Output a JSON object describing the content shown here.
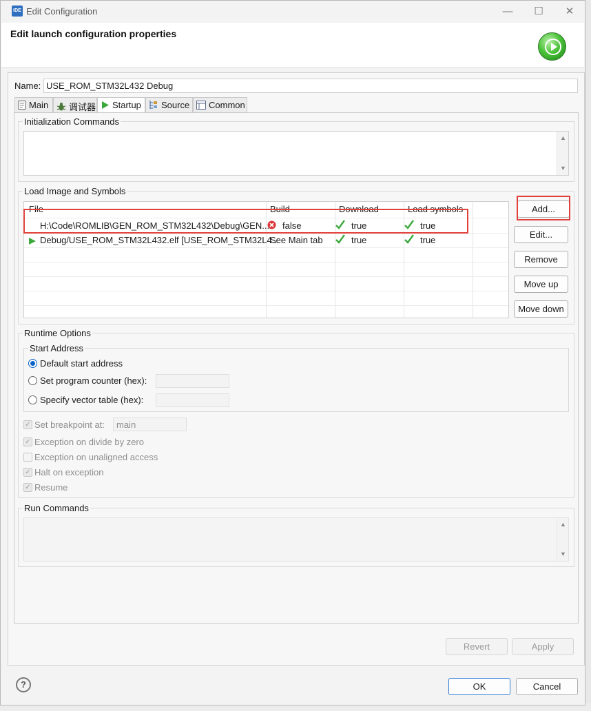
{
  "window": {
    "title": "Edit Configuration",
    "app_icon_text": "IDE",
    "minimize": "—",
    "maximize": "☐",
    "close": "✕"
  },
  "header": {
    "title": "Edit launch configuration properties"
  },
  "config": {
    "name_label": "Name:",
    "name_value": "USE_ROM_STM32L432 Debug"
  },
  "tabs": [
    {
      "label": "Main",
      "icon": "document-icon",
      "active": false
    },
    {
      "label": "调试器",
      "icon": "bug-icon",
      "active": false
    },
    {
      "label": "Startup",
      "icon": "play-icon",
      "active": true
    },
    {
      "label": "Source",
      "icon": "source-icon",
      "active": false
    },
    {
      "label": "Common",
      "icon": "common-icon",
      "active": false
    }
  ],
  "init": {
    "label": "Initialization Commands",
    "value": ""
  },
  "load": {
    "label": "Load Image and Symbols",
    "columns": [
      "File",
      "Build",
      "Download",
      "Load symbols"
    ],
    "rows": [
      {
        "file": "H:\\Code\\ROMLIB\\GEN_ROM_STM32L432\\Debug\\GEN...",
        "build": "false",
        "build_icon": "error-icon",
        "download": "true",
        "symbols": "true"
      },
      {
        "file": "Debug/USE_ROM_STM32L432.elf [USE_ROM_STM32L4...",
        "build": "See Main tab",
        "build_icon": "",
        "download": "true",
        "symbols": "true"
      }
    ],
    "buttons": [
      "Add...",
      "Edit...",
      "Remove",
      "Move up",
      "Move down"
    ]
  },
  "runtime": {
    "label": "Runtime Options",
    "start_address_label": "Start Address",
    "options": [
      {
        "label": "Default start address",
        "selected": true
      },
      {
        "label": "Set program counter (hex):",
        "selected": false
      },
      {
        "label": "Specify vector table (hex):",
        "selected": false
      }
    ],
    "breakpoint_label": "Set breakpoint at:",
    "breakpoint_value": "main",
    "checks": [
      {
        "label": "Exception on divide by zero",
        "checked": true
      },
      {
        "label": "Exception on unaligned access",
        "checked": false
      },
      {
        "label": "Halt on exception",
        "checked": true
      },
      {
        "label": "Resume",
        "checked": true
      }
    ]
  },
  "run_commands": {
    "label": "Run Commands",
    "value": ""
  },
  "footer": {
    "revert": "Revert",
    "apply": "Apply",
    "ok": "OK",
    "cancel": "Cancel",
    "help": "?"
  },
  "colors": {
    "accent": "#0a63c9",
    "highlight": "#e0413a",
    "run_green": "#4cc23a",
    "check_green": "#3aa83a",
    "error_red": "#d9383a"
  }
}
